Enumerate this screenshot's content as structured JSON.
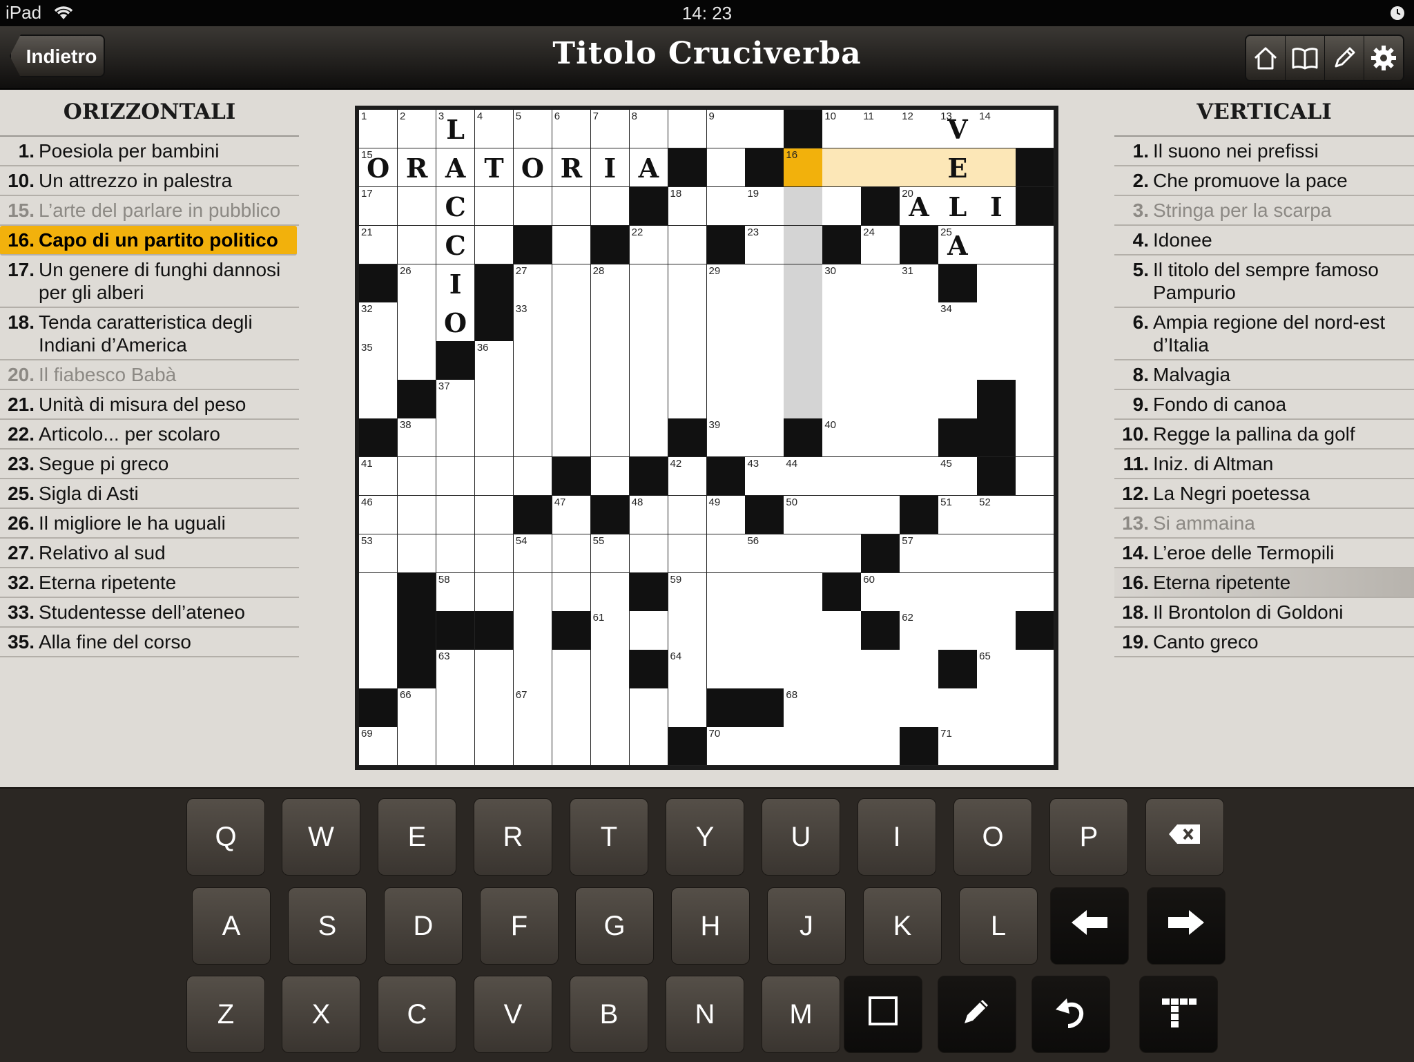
{
  "status_bar": {
    "device": "iPad",
    "time": "14: 23"
  },
  "nav": {
    "back_label": "Indietro",
    "title": "Titolo Cruciverba",
    "tools": [
      "home-icon",
      "book-icon",
      "pencil-icon",
      "gear-icon"
    ]
  },
  "across": {
    "heading": "ORIZZONTALI",
    "clues": [
      {
        "num": "1.",
        "text": "Poesiola per bambini",
        "state": "normal"
      },
      {
        "num": "10.",
        "text": "Un attrezzo in palestra",
        "state": "normal"
      },
      {
        "num": "15.",
        "text": "L’arte del parlare in pubblico",
        "state": "dim"
      },
      {
        "num": "16.",
        "text": "Capo di un partito politico",
        "state": "active"
      },
      {
        "num": "17.",
        "text": "Un genere di funghi dannosi per gli alberi",
        "state": "normal"
      },
      {
        "num": "18.",
        "text": "Tenda caratteristica degli Indiani d’America",
        "state": "normal"
      },
      {
        "num": "20.",
        "text": "Il fiabesco Babà",
        "state": "dim"
      },
      {
        "num": "21.",
        "text": "Unità di misura del peso",
        "state": "normal"
      },
      {
        "num": "22.",
        "text": "Articolo... per scolaro",
        "state": "normal"
      },
      {
        "num": "23.",
        "text": "Segue pi greco",
        "state": "normal"
      },
      {
        "num": "25.",
        "text": "Sigla di Asti",
        "state": "normal"
      },
      {
        "num": "26.",
        "text": "Il migliore le ha uguali",
        "state": "normal"
      },
      {
        "num": "27.",
        "text": "Relativo al sud",
        "state": "normal"
      },
      {
        "num": "32.",
        "text": "Eterna ripetente",
        "state": "normal"
      },
      {
        "num": "33.",
        "text": "Studentesse dell’ateneo",
        "state": "normal"
      },
      {
        "num": "35.",
        "text": "Alla fine del corso",
        "state": "normal"
      }
    ]
  },
  "down": {
    "heading": "VERTICALI",
    "clues": [
      {
        "num": "1.",
        "text": "Il suono nei prefissi",
        "state": "normal"
      },
      {
        "num": "2.",
        "text": "Che promuove la pace",
        "state": "normal"
      },
      {
        "num": "3.",
        "text": "Stringa per la scarpa",
        "state": "dim"
      },
      {
        "num": "4.",
        "text": "Idonee",
        "state": "normal"
      },
      {
        "num": "5.",
        "text": "Il titolo del sempre famoso Pampurio",
        "state": "normal"
      },
      {
        "num": "6.",
        "text": "Ampia regione del nord-est d’Italia",
        "state": "normal"
      },
      {
        "num": "8.",
        "text": "Malvagia",
        "state": "normal"
      },
      {
        "num": "9.",
        "text": "Fondo di canoa",
        "state": "normal"
      },
      {
        "num": "10.",
        "text": "Regge la pallina da golf",
        "state": "normal"
      },
      {
        "num": "11.",
        "text": "Iniz. di Altman",
        "state": "normal"
      },
      {
        "num": "12.",
        "text": "La Negri poetessa",
        "state": "normal"
      },
      {
        "num": "13.",
        "text": "Si ammaina",
        "state": "dim"
      },
      {
        "num": "14.",
        "text": "L’eroe delle Termopili",
        "state": "normal"
      },
      {
        "num": "16.",
        "text": "Eterna ripetente",
        "state": "selected"
      },
      {
        "num": "18.",
        "text": "Il Brontolon di Goldoni",
        "state": "normal"
      },
      {
        "num": "19.",
        "text": "Canto greco",
        "state": "normal"
      }
    ]
  },
  "puzzle": {
    "rows": 17,
    "cols": 18,
    "blocks": [
      [
        0,
        11
      ],
      [
        1,
        8
      ],
      [
        1,
        10
      ],
      [
        1,
        17
      ],
      [
        2,
        7
      ],
      [
        2,
        13
      ],
      [
        2,
        17
      ],
      [
        3,
        4
      ],
      [
        3,
        6
      ],
      [
        3,
        9
      ],
      [
        3,
        12
      ],
      [
        3,
        14
      ],
      [
        4,
        0
      ],
      [
        4,
        3
      ],
      [
        4,
        15
      ],
      [
        5,
        3
      ],
      [
        6,
        2
      ],
      [
        7,
        1
      ],
      [
        7,
        16
      ],
      [
        8,
        0
      ],
      [
        8,
        8
      ],
      [
        8,
        11
      ],
      [
        8,
        15
      ],
      [
        8,
        16
      ],
      [
        9,
        5
      ],
      [
        9,
        7
      ],
      [
        9,
        9
      ],
      [
        9,
        16
      ],
      [
        10,
        4
      ],
      [
        10,
        6
      ],
      [
        10,
        10
      ],
      [
        10,
        14
      ],
      [
        11,
        13
      ],
      [
        12,
        1
      ],
      [
        12,
        7
      ],
      [
        12,
        12
      ],
      [
        13,
        1
      ],
      [
        13,
        2
      ],
      [
        13,
        3
      ],
      [
        13,
        5
      ],
      [
        13,
        13
      ],
      [
        13,
        17
      ],
      [
        14,
        1
      ],
      [
        14,
        7
      ],
      [
        14,
        15
      ],
      [
        15,
        0
      ],
      [
        15,
        9
      ],
      [
        15,
        10
      ],
      [
        16,
        8
      ],
      [
        16,
        14
      ]
    ],
    "numbers": [
      [
        0,
        0,
        "1"
      ],
      [
        0,
        1,
        "2"
      ],
      [
        0,
        2,
        "3"
      ],
      [
        0,
        3,
        "4"
      ],
      [
        0,
        4,
        "5"
      ],
      [
        0,
        5,
        "6"
      ],
      [
        0,
        6,
        "7"
      ],
      [
        0,
        7,
        "8"
      ],
      [
        0,
        9,
        "9"
      ],
      [
        0,
        12,
        "10"
      ],
      [
        0,
        13,
        "11"
      ],
      [
        0,
        14,
        "12"
      ],
      [
        0,
        15,
        "13"
      ],
      [
        0,
        16,
        "14"
      ],
      [
        1,
        0,
        "15"
      ],
      [
        1,
        11,
        "16"
      ],
      [
        2,
        0,
        "17"
      ],
      [
        2,
        8,
        "18"
      ],
      [
        2,
        10,
        "19"
      ],
      [
        2,
        14,
        "20"
      ],
      [
        3,
        0,
        "21"
      ],
      [
        3,
        7,
        "22"
      ],
      [
        3,
        10,
        "23"
      ],
      [
        3,
        13,
        "24"
      ],
      [
        3,
        15,
        "25"
      ],
      [
        4,
        1,
        "26"
      ],
      [
        4,
        4,
        "27"
      ],
      [
        4,
        6,
        "28"
      ],
      [
        4,
        9,
        "29"
      ],
      [
        4,
        12,
        "30"
      ],
      [
        4,
        14,
        "31"
      ],
      [
        5,
        0,
        "32"
      ],
      [
        5,
        4,
        "33"
      ],
      [
        5,
        15,
        "34"
      ],
      [
        6,
        0,
        "35"
      ],
      [
        6,
        3,
        "36"
      ],
      [
        7,
        2,
        "37"
      ],
      [
        8,
        1,
        "38"
      ],
      [
        8,
        9,
        "39"
      ],
      [
        8,
        12,
        "40"
      ],
      [
        9,
        0,
        "41"
      ],
      [
        9,
        8,
        "42"
      ],
      [
        9,
        10,
        "43"
      ],
      [
        9,
        11,
        "44"
      ],
      [
        9,
        15,
        "45"
      ],
      [
        10,
        0,
        "46"
      ],
      [
        10,
        5,
        "47"
      ],
      [
        10,
        7,
        "48"
      ],
      [
        10,
        9,
        "49"
      ],
      [
        10,
        11,
        "50"
      ],
      [
        10,
        15,
        "51"
      ],
      [
        10,
        16,
        "52"
      ],
      [
        11,
        0,
        "53"
      ],
      [
        11,
        4,
        "54"
      ],
      [
        11,
        6,
        "55"
      ],
      [
        11,
        10,
        "56"
      ],
      [
        11,
        14,
        "57"
      ],
      [
        12,
        2,
        "58"
      ],
      [
        12,
        8,
        "59"
      ],
      [
        12,
        13,
        "60"
      ],
      [
        13,
        6,
        "61"
      ],
      [
        13,
        14,
        "62"
      ],
      [
        14,
        2,
        "63"
      ],
      [
        14,
        8,
        "64"
      ],
      [
        14,
        16,
        "65"
      ],
      [
        15,
        1,
        "66"
      ],
      [
        15,
        4,
        "67"
      ],
      [
        15,
        11,
        "68"
      ],
      [
        16,
        0,
        "69"
      ],
      [
        16,
        9,
        "70"
      ],
      [
        16,
        15,
        "71"
      ]
    ],
    "letters": [
      [
        0,
        2,
        "L"
      ],
      [
        0,
        15,
        "V"
      ],
      [
        1,
        0,
        "O"
      ],
      [
        1,
        1,
        "R"
      ],
      [
        1,
        2,
        "A"
      ],
      [
        1,
        3,
        "T"
      ],
      [
        1,
        4,
        "O"
      ],
      [
        1,
        5,
        "R"
      ],
      [
        1,
        6,
        "I"
      ],
      [
        1,
        7,
        "A"
      ],
      [
        1,
        15,
        "E"
      ],
      [
        2,
        2,
        "C"
      ],
      [
        2,
        14,
        "A"
      ],
      [
        2,
        15,
        "L"
      ],
      [
        2,
        16,
        "I"
      ],
      [
        3,
        2,
        "C"
      ],
      [
        3,
        15,
        "A"
      ],
      [
        4,
        2,
        "I"
      ],
      [
        5,
        2,
        "O"
      ]
    ],
    "current_cell": [
      1,
      11
    ],
    "current_word": [
      [
        1,
        12
      ],
      [
        1,
        13
      ],
      [
        1,
        14
      ],
      [
        1,
        15
      ],
      [
        1,
        16
      ]
    ],
    "down_column": [
      [
        2,
        11
      ],
      [
        3,
        11
      ],
      [
        4,
        11
      ],
      [
        5,
        11
      ],
      [
        6,
        11
      ],
      [
        7,
        11
      ]
    ]
  },
  "keyboard": {
    "rows": [
      [
        "Q",
        "W",
        "E",
        "R",
        "T",
        "Y",
        "U",
        "I",
        "O",
        "P",
        "backspace-icon"
      ],
      [
        "A",
        "S",
        "D",
        "F",
        "G",
        "H",
        "J",
        "K",
        "L",
        "arrow-left-icon",
        "arrow-right-icon"
      ],
      [
        "Z",
        "X",
        "C",
        "V",
        "B",
        "N",
        "M",
        "square-icon",
        "pencil-icon",
        "undo-icon",
        "grid-cross-icon"
      ]
    ]
  },
  "colors": {
    "accent": "#f2b10c",
    "word_highlight": "#fce7b7",
    "block": "#111111"
  }
}
